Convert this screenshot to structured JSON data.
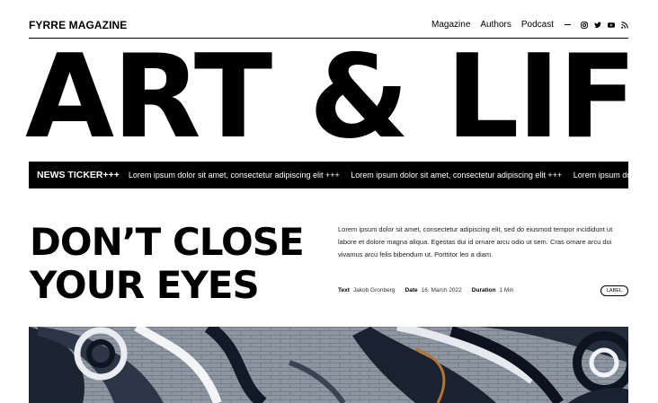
{
  "header": {
    "brand": "FYRRE MAGAZINE",
    "nav": [
      "Magazine",
      "Authors",
      "Podcast"
    ],
    "social_icons": [
      "instagram-icon",
      "twitter-icon",
      "youtube-icon",
      "rss-icon"
    ]
  },
  "hero": {
    "title": "ART & LIFE"
  },
  "ticker": {
    "label": "NEWS TICKER+++",
    "items": [
      "Lorem ipsum dolor sit amet, consectetur adipiscing elit +++",
      "Lorem ipsum dolor sit amet, consectetur adipiscing elit +++",
      "Lorem ipsum dolor sit amet, consectetur adipiscing elit +++"
    ]
  },
  "article": {
    "headline_line1": "DON’T CLOSE",
    "headline_line2": "YOUR EYES",
    "intro": "Lorem ipsum dolor sit amet, consectetur adipiscing elit, sed do eiusmod tempor incididunt ut labore et dolore magna aliqua. Egestas dui id ornare arcu odio ut sem. Cras ornare arcu dui vivamus arcu felis bibendum ut. Porttitor leo a diam.",
    "meta": {
      "text_label": "Text",
      "text_value": "Jakob Gronberg",
      "date_label": "Date",
      "date_value": "16. March 2022",
      "duration_label": "Duration",
      "duration_value": "1 Min"
    },
    "tag": "LABEL"
  },
  "colors": {
    "background": "#ffffff",
    "ink": "#000000",
    "ticker_bg": "#000000"
  }
}
